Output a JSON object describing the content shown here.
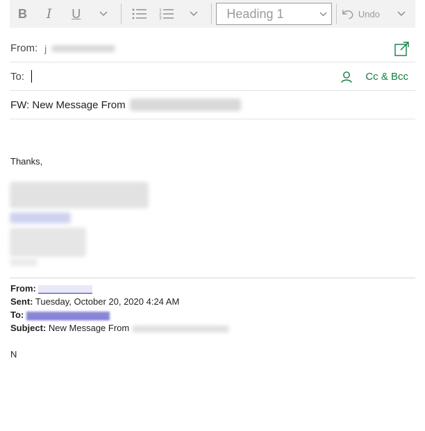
{
  "toolbar": {
    "bold": "B",
    "italic": "I",
    "underline": "U",
    "chevron": "⌄",
    "bullets_icon": "bulleted-list-icon",
    "numbers_icon": "numbered-list-icon",
    "heading_value": "Heading 1",
    "undo_label": "Undo"
  },
  "header": {
    "from_label": "From:",
    "from_value": "j",
    "to_label": "To:",
    "cc_bcc": "Cc & Bcc",
    "subject": "FW: New Message From"
  },
  "body": {
    "thanks": "Thanks,"
  },
  "quoted": {
    "from_label": "From:",
    "sent_label": "Sent:",
    "sent_value": "Tuesday, October 20, 2020 4:24 AM",
    "to_label": "To:",
    "subject_label": "Subject:",
    "subject_value": "New Message From",
    "trailing": "N"
  },
  "colors": {
    "accent": "#107c41",
    "toolbar_bg": "#f2f2f2",
    "link": "#2b2bd6"
  }
}
